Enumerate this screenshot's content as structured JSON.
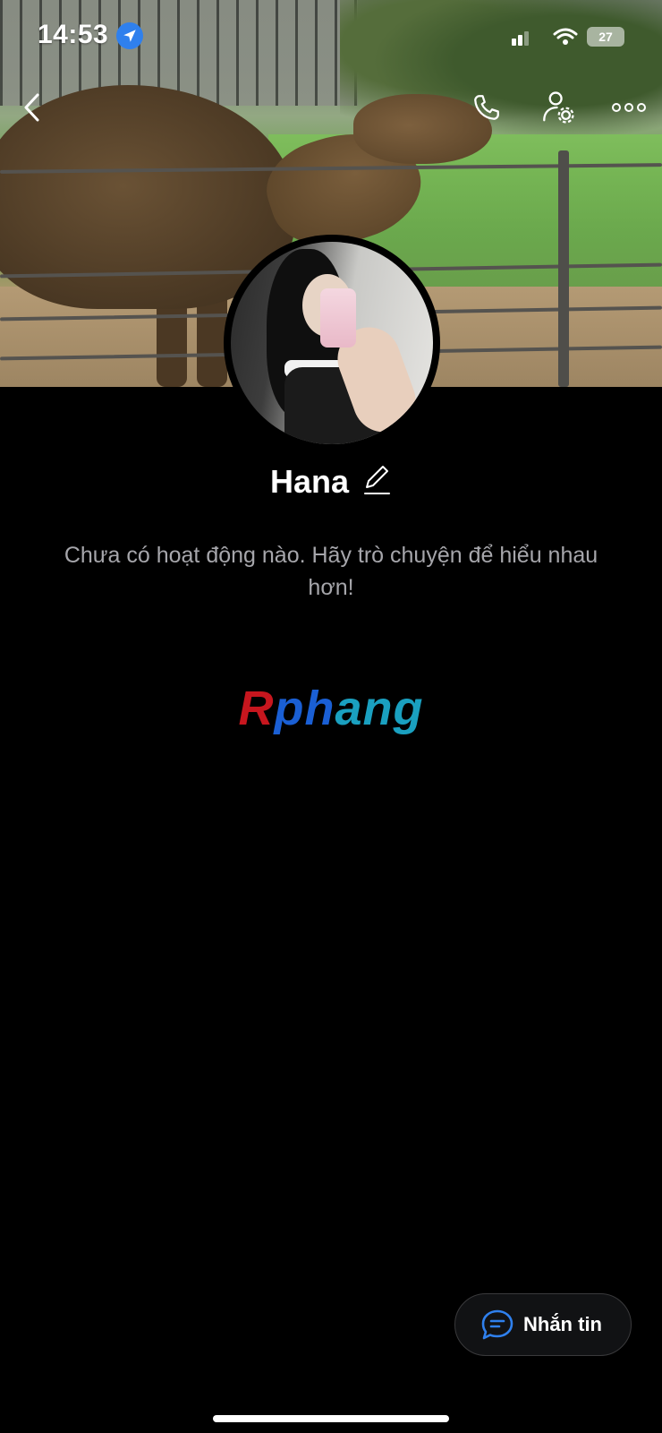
{
  "status_bar": {
    "time": "14:53",
    "battery": "27"
  },
  "profile": {
    "name": "Hana",
    "empty_message": "Chưa có hoạt động nào. Hãy trò chuyện để hiểu nhau hơn!"
  },
  "watermark": {
    "part1": "R",
    "part2": "ph",
    "part3": "ang"
  },
  "message_button": {
    "label": "Nhắn tin"
  },
  "colors": {
    "background": "#000000",
    "location_badge": "#2f80ed",
    "message_icon": "#2f80ed"
  },
  "icons": [
    "back-chevron-icon",
    "phone-icon",
    "user-settings-icon",
    "more-icon",
    "location-arrow-icon",
    "edit-pencil-icon",
    "chat-bubble-icon"
  ]
}
